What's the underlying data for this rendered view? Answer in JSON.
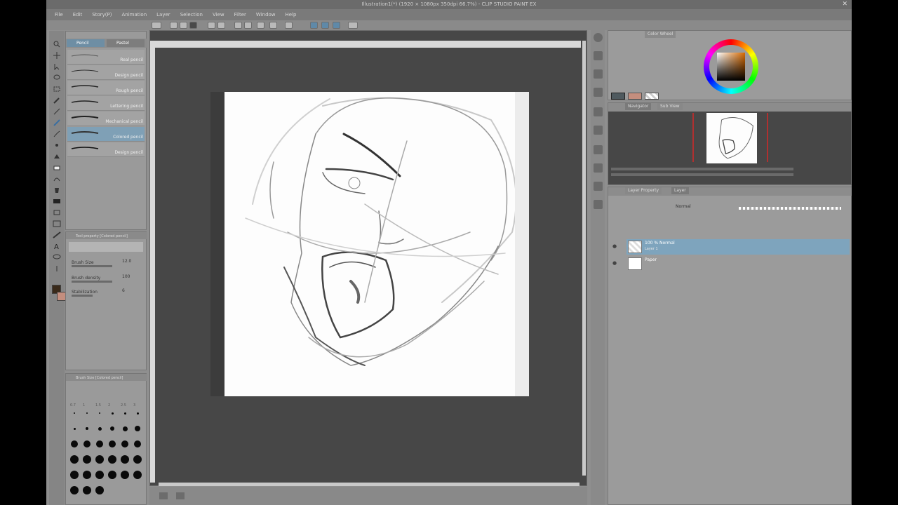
{
  "window": {
    "title": "Illustration1(*) (1920 × 1080px 350dpi 66.7%) - CLIP STUDIO PAINT EX",
    "close_glyph": "✕"
  },
  "menu": [
    "File",
    "Edit",
    "Story(P)",
    "Animation",
    "Layer",
    "Selection",
    "View",
    "Filter",
    "Window",
    "Help"
  ],
  "subtool": {
    "tabs": [
      "Pencil",
      "Pastel"
    ],
    "brushes": [
      {
        "name": "Real pencil"
      },
      {
        "name": "Design pencil"
      },
      {
        "name": "Rough pencil"
      },
      {
        "name": "Lettering pencil"
      },
      {
        "name": "Mechanical pencil"
      },
      {
        "name": "Colored pencil",
        "selected": true
      },
      {
        "name": "Design pencil"
      }
    ]
  },
  "tool_property": {
    "title": "Tool property [Colored pencil]",
    "rows": [
      {
        "label": "Brush Size",
        "value": "12.0"
      },
      {
        "label": "Brush density",
        "value": "100"
      },
      {
        "label": "Stabilization",
        "value": "6"
      }
    ]
  },
  "brush_size": {
    "title": "Brush Size [Colored pencil]",
    "labels": [
      "0.7",
      "1",
      "1.5",
      "2",
      "2.5",
      "3"
    ]
  },
  "color": {
    "main_color": "#3a2a1a",
    "sub_color": "#c48e7e",
    "panel_tab": "Color Wheel"
  },
  "navigator": {
    "tabs": [
      "Navigator",
      "Sub View"
    ]
  },
  "layers": {
    "tabs": [
      "Layer Property",
      "Layer"
    ],
    "blend_mode": "Normal",
    "items": [
      {
        "name": "100 % Normal",
        "sub": "Layer 1",
        "selected": true
      },
      {
        "name": "Paper",
        "sub": "",
        "selected": false
      }
    ]
  }
}
